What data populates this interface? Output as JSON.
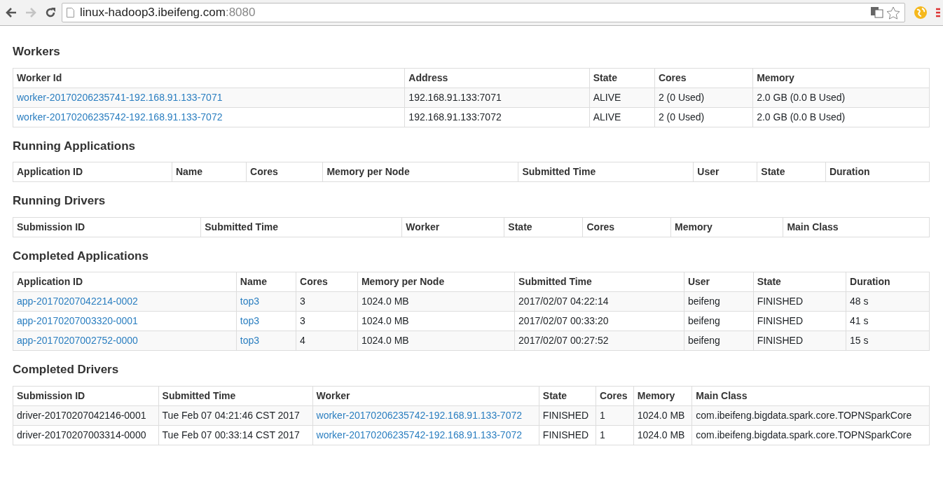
{
  "browser": {
    "back": {
      "disabled": false
    },
    "forward": {
      "disabled": true
    },
    "address": {
      "host": "linux-hadoop3.ibeifeng.com",
      "port": ":8080"
    }
  },
  "sections": [
    {
      "title": "Workers",
      "columns": [
        {
          "label": "Worker Id",
          "kind": "link"
        },
        {
          "label": "Address",
          "kind": "text"
        },
        {
          "label": "State",
          "kind": "text"
        },
        {
          "label": "Cores",
          "kind": "text"
        },
        {
          "label": "Memory",
          "kind": "text"
        }
      ],
      "rows": [
        [
          "worker-20170206235741-192.168.91.133-7071",
          "192.168.91.133:7071",
          "ALIVE",
          "2 (0 Used)",
          "2.0 GB (0.0 B Used)"
        ],
        [
          "worker-20170206235742-192.168.91.133-7072",
          "192.168.91.133:7072",
          "ALIVE",
          "2 (0 Used)",
          "2.0 GB (0.0 B Used)"
        ]
      ]
    },
    {
      "title": "Running Applications",
      "columns": [
        {
          "label": "Application ID"
        },
        {
          "label": "Name"
        },
        {
          "label": "Cores"
        },
        {
          "label": "Memory per Node"
        },
        {
          "label": "Submitted Time"
        },
        {
          "label": "User"
        },
        {
          "label": "State"
        },
        {
          "label": "Duration"
        }
      ]
    },
    {
      "title": "Running Drivers",
      "columns": [
        {
          "label": "Submission ID"
        },
        {
          "label": "Submitted Time"
        },
        {
          "label": "Worker"
        },
        {
          "label": "State"
        },
        {
          "label": "Cores"
        },
        {
          "label": "Memory"
        },
        {
          "label": "Main Class"
        }
      ]
    },
    {
      "title": "Completed Applications",
      "columns": [
        {
          "label": "Application ID",
          "kind": "link"
        },
        {
          "label": "Name",
          "kind": "link"
        },
        {
          "label": "Cores",
          "kind": "text"
        },
        {
          "label": "Memory per Node",
          "kind": "text"
        },
        {
          "label": "Submitted Time",
          "kind": "text"
        },
        {
          "label": "User",
          "kind": "text"
        },
        {
          "label": "State",
          "kind": "text"
        },
        {
          "label": "Duration",
          "kind": "text"
        }
      ],
      "rows": [
        [
          "app-20170207042214-0002",
          "top3",
          "3",
          "1024.0 MB",
          "2017/02/07 04:22:14",
          "beifeng",
          "FINISHED",
          "48 s"
        ],
        [
          "app-20170207003320-0001",
          "top3",
          "3",
          "1024.0 MB",
          "2017/02/07 00:33:20",
          "beifeng",
          "FINISHED",
          "41 s"
        ],
        [
          "app-20170207002752-0000",
          "top3",
          "4",
          "1024.0 MB",
          "2017/02/07 00:27:52",
          "beifeng",
          "FINISHED",
          "15 s"
        ]
      ]
    },
    {
      "title": "Completed Drivers",
      "columns": [
        {
          "label": "Submission ID",
          "kind": "text"
        },
        {
          "label": "Submitted Time",
          "kind": "text"
        },
        {
          "label": "Worker",
          "kind": "link"
        },
        {
          "label": "State",
          "kind": "text"
        },
        {
          "label": "Cores",
          "kind": "text"
        },
        {
          "label": "Memory",
          "kind": "text"
        },
        {
          "label": "Main Class",
          "kind": "text"
        }
      ],
      "rows": [
        [
          "driver-20170207042146-0001",
          "Tue Feb 07 04:21:46 CST 2017",
          "worker-20170206235742-192.168.91.133-7072",
          "FINISHED",
          "1",
          "1024.0 MB",
          "com.ibeifeng.bigdata.spark.core.TOPNSparkCore"
        ],
        [
          "driver-20170207003314-0000",
          "Tue Feb 07 00:33:14 CST 2017",
          "worker-20170206235742-192.168.91.133-7072",
          "FINISHED",
          "1",
          "1024.0 MB",
          "com.ibeifeng.bigdata.spark.core.TOPNSparkCore"
        ]
      ]
    }
  ]
}
